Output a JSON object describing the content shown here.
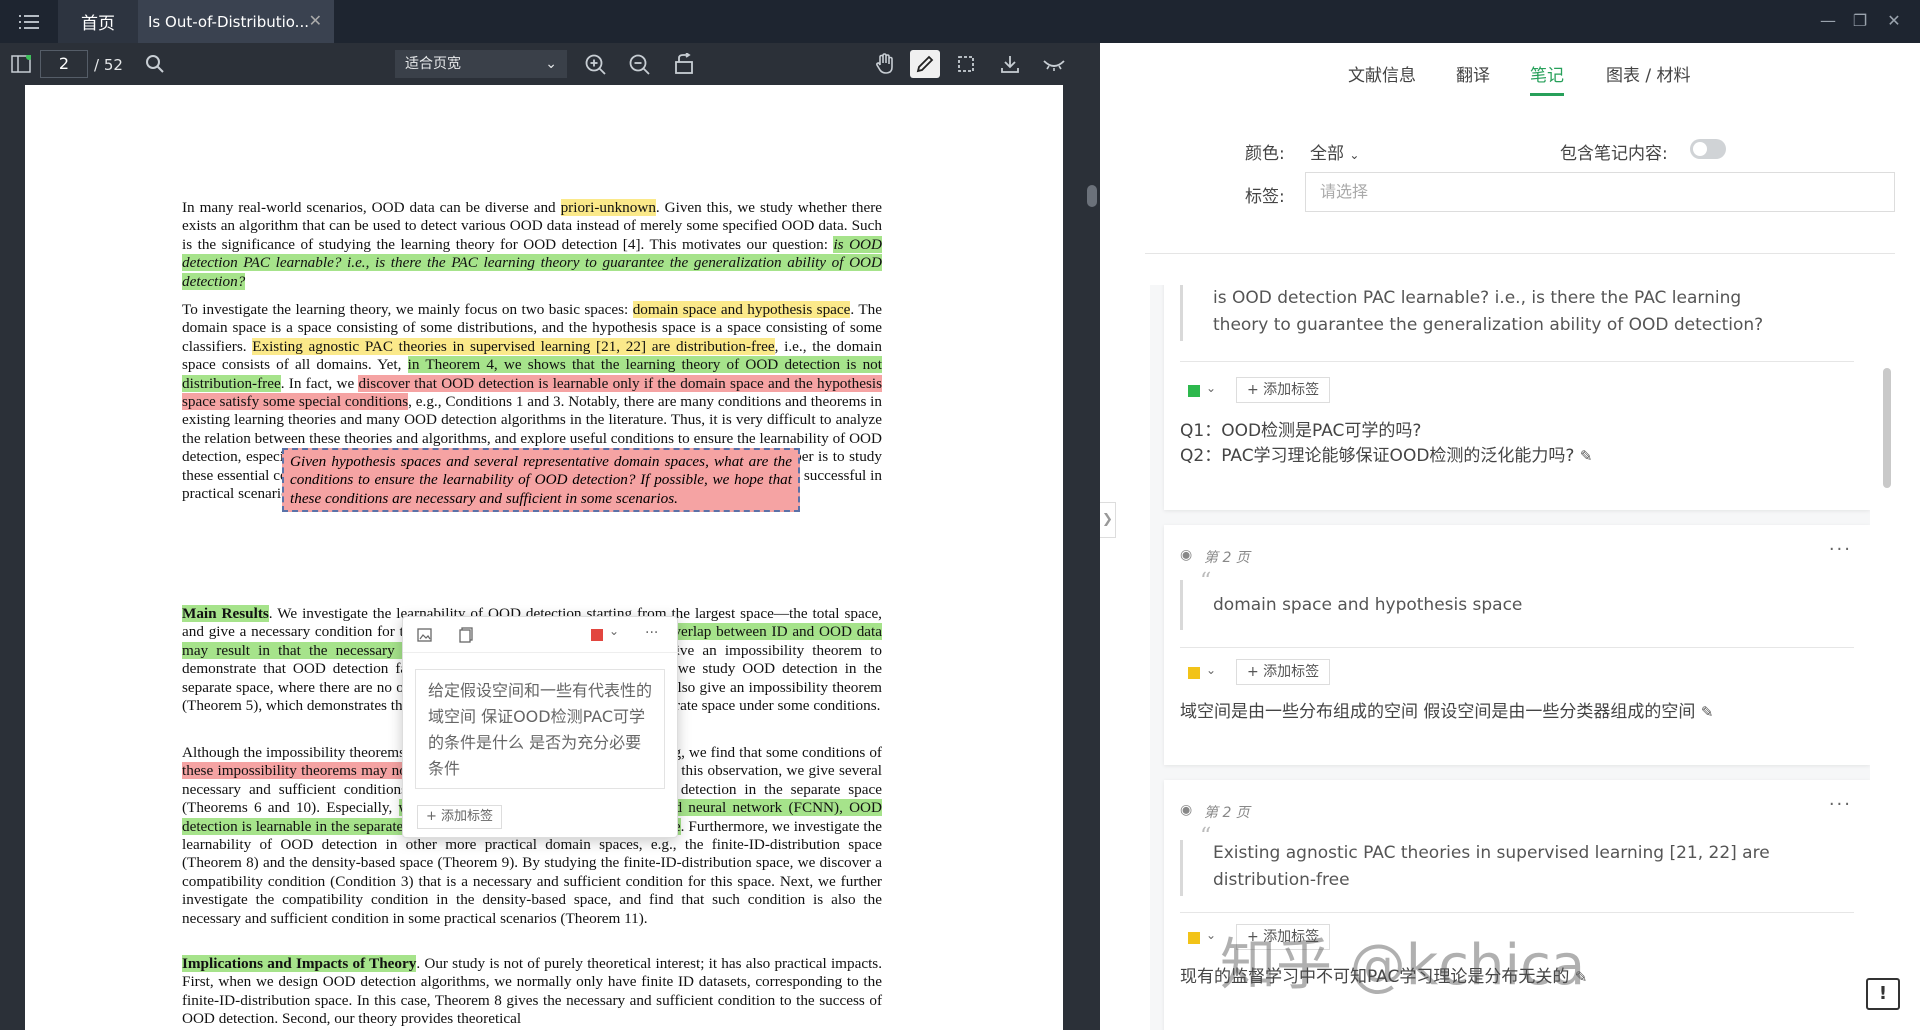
{
  "titlebar": {
    "home_tab": "首页",
    "doc_tab": "Is Out-of-Distributio...",
    "close": "✕",
    "minimize": "—",
    "restore": "❐",
    "close_window": "✕"
  },
  "toolbar": {
    "page_current": "2",
    "page_total": "/ 52",
    "zoom_mode": "适合页宽"
  },
  "pdf": {
    "p1": [
      {
        "t": "In many real-world scenarios, OOD data can be diverse and ",
        "c": ""
      },
      {
        "t": "priori-unknown",
        "c": "hl-y"
      },
      {
        "t": ". Given this, we study whether there exists an algorithm that can be used to detect various OOD data instead of merely some specified OOD data. Such is the significance of studying the learning theory for OOD detection [4]. This motivates our question: ",
        "c": ""
      },
      {
        "t": "is OOD detection PAC learnable? i.e., is there the PAC learning theory to guarantee the generalization ability of OOD detection?",
        "c": "hl-g ital"
      }
    ],
    "p2": [
      {
        "t": "To investigate the learning theory, we mainly focus on two basic spaces: ",
        "c": ""
      },
      {
        "t": "domain space and hypothesis space",
        "c": "hl-y"
      },
      {
        "t": ". The domain space is a space consisting of some distributions, and the hypothesis space is a space consisting of some classifiers. ",
        "c": ""
      },
      {
        "t": "Existing agnostic PAC theories in supervised learning [21, 22] are distribution-free",
        "c": "hl-y"
      },
      {
        "t": ", i.e., the domain space consists of all domains. Yet, ",
        "c": ""
      },
      {
        "t": "in Theorem 4, we shows that the learning theory of OOD detection is not distribution-free",
        "c": "hl-g"
      },
      {
        "t": ". In fact, we ",
        "c": ""
      },
      {
        "t": "discover that OOD detection is learnable only if the domain space and the hypothesis space satisfy some special conditions",
        "c": "hl-r"
      },
      {
        "t": ", e.g., Conditions 1 and 3. Notably, there are many conditions and theorems in existing learning theories and many OOD detection algorithms in the literature. Thus, it is very difficult to analyze the relation between these theories and algorithms, and explore useful conditions to ensure the learnability of OOD detection, especially when we have to explore them from the scratch. Thus, the main aim of our paper is to study these essential conditions. From these essential conditions, we can know when OOD detection can be successful in practical scenarios. We restate our question and goal in following:",
        "c": ""
      }
    ],
    "boxed": "Given hypothesis spaces and several representative domain spaces, what are the conditions to ensure the learnability of OOD detection? If possible, we hope that these conditions are necessary and sufficient in some scenarios.",
    "p3": [
      {
        "t": "Main Results",
        "c": "hl-g b"
      },
      {
        "t": ". We investigate the learnability of OOD detection starting from the largest space—the total space, and give a necessary condition for the learnability. However, we find that ",
        "c": ""
      },
      {
        "t": "the overlap between ID and OOD data may result in that the necessary condition does not hold",
        "c": "hl-g"
      },
      {
        "t": ". Therefore, we give an impossibility theorem to demonstrate that OOD detection fails in the total space (Theorem 4). Next, we study OOD detection in the separate space, where there are no overlaps between the ID and OOD data. We also give an impossibility theorem (Theorem 5), which demonstrates that OOD detection is not learnable in the separate space under some conditions.",
        "c": ""
      }
    ],
    "p4": [
      {
        "t": "Although the impossibility theorems obtained in the separate space are frustrating, we find that some conditions of ",
        "c": ""
      },
      {
        "t": "these impossibility theorems may not hold in some practical scenarios",
        "c": "hl-r"
      },
      {
        "t": ". Based on this observation, we give several necessary and sufficient conditions to characterize the learnability of OOD detection in the separate space (Theorems 6 and 10). Especially, ",
        "c": ""
      },
      {
        "t": "when our model is based on fully-connected neural network (FCNN), OOD detection is learnable in the separate space if and only if the feature space is finite",
        "c": "hl-g"
      },
      {
        "t": ". Furthermore, we investigate the learnability of OOD detection in other more practical domain spaces, e.g., the finite-ID-distribution space (Theorem 8) and the density-based space (Theorem 9). By studying the finite-ID-distribution space, we discover a compatibility condition (Condition 3) that is a necessary and sufficient condition for this space. Next, we further investigate the compatibility condition in the density-based space, and find that such condition is also the necessary and sufficient condition in some practical scenarios (Theorem 11).",
        "c": ""
      }
    ],
    "p5": [
      {
        "t": "Implications and Impacts of Theory",
        "c": "hl-g b"
      },
      {
        "t": ". Our study is not of purely theoretical interest; it has also practical impacts. First, when we design OOD detection algorithms, we normally only have finite ID datasets, corresponding to the finite-ID-distribution space. In this case, Theorem 8 gives the necessary and sufficient condition to the success of OOD detection. Second, our theory provides theoretical",
        "c": ""
      }
    ]
  },
  "popup": {
    "note_text": "给定假设空间和一些有代表性的域空间 保证OOD检测PAC可学的条件是什么 是否为充分必要条件",
    "add_tag": "+ 添加标签",
    "more": "···"
  },
  "right_tabs": [
    "文献信息",
    "翻译",
    "笔记",
    "图表 / 材料"
  ],
  "filters": {
    "color_label": "颜色:",
    "color_value": "全部",
    "include_label": "包含笔记内容:",
    "tag_label": "标签:",
    "tag_placeholder": "请选择"
  },
  "notes": [
    {
      "quote": "is OOD detection PAC learnable? i.e., is there the PAC learning theory to guarantee the generalization ability of OOD detection?",
      "color": "#2db84d",
      "add_tag": "+ 添加标签",
      "body1": "Q1：OOD检测是PAC可学的吗?",
      "body2": "Q2：PAC学习理论能够保证OOD检测的泛化能力吗?"
    },
    {
      "page": "第 2 页",
      "quote": "domain space and hypothesis space",
      "color": "#f2c318",
      "add_tag": "+ 添加标签",
      "body1": "域空间是由一些分布组成的空间 假设空间是由一些分类器组成的空间"
    },
    {
      "page": "第 2 页",
      "quote": "Existing agnostic PAC theories in supervised learning [21, 22] are distribution-free",
      "color": "#f2c318",
      "add_tag": "+ 添加标签",
      "body1": "现有的监督学习中不可知PAC学习理论是分布无关的"
    }
  ],
  "watermark": "知乎 @kchica",
  "fab": "!"
}
